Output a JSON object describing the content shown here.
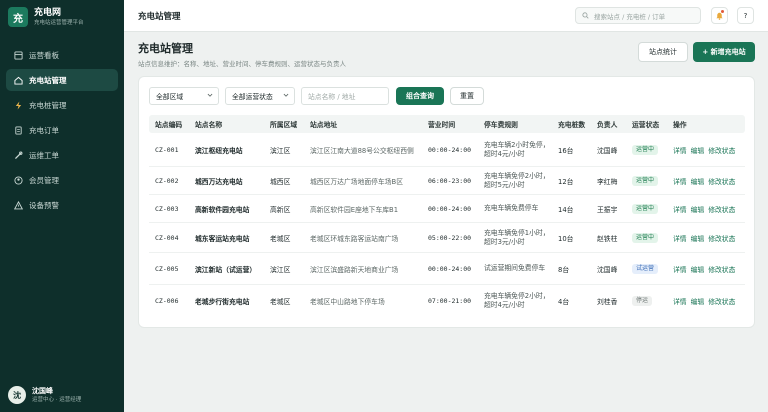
{
  "brand": {
    "logo": "充",
    "name": "充电网",
    "subtitle": "充电站运营管理平台"
  },
  "sidebar": {
    "items": [
      {
        "label": "运营看板",
        "icon": "dashboard-icon"
      },
      {
        "label": "充电站管理",
        "icon": "home-icon",
        "active": true
      },
      {
        "label": "充电桩管理",
        "icon": "bolt-icon"
      },
      {
        "label": "充电订单",
        "icon": "document-icon"
      },
      {
        "label": "运维工单",
        "icon": "wrench-icon"
      },
      {
        "label": "会员管理",
        "icon": "member-icon"
      },
      {
        "label": "设备预警",
        "icon": "warning-icon"
      }
    ]
  },
  "user": {
    "avatar": "沈",
    "name": "沈国峰",
    "role": "运营中心 · 运营经理"
  },
  "topbar": {
    "title": "充电站管理",
    "search_placeholder": "搜索站点 / 充电桩 / 订单",
    "help": "?"
  },
  "page": {
    "title": "充电站管理",
    "desc": "站点信息维护：名称、地址、营业时间、停车费规则、运营状态与负责人",
    "stats_button": "站点统计",
    "add_button": "+ 新增充电站"
  },
  "filters": {
    "region": "全部区域",
    "status": "全部运营状态",
    "keyword_placeholder": "站点名称 / 地址",
    "query_button": "组合查询",
    "reset_button": "重置"
  },
  "table": {
    "headers": [
      "站点编码",
      "站点名称",
      "所属区域",
      "站点地址",
      "营业时间",
      "停车费规则",
      "充电桩数",
      "负责人",
      "运营状态",
      "操作"
    ],
    "rows": [
      {
        "code": "CZ-001",
        "name": "滨江枢纽充电站",
        "region": "滨江区",
        "address": "滨江区江南大道88号公交枢纽西侧",
        "hours": "00:00-24:00",
        "rule": "充电车辆2小时免停，超时4元/小时",
        "piles": "16台",
        "owner": "沈国峰",
        "status": "运营中",
        "status_kind": "green"
      },
      {
        "code": "CZ-002",
        "name": "城西万达充电站",
        "region": "城西区",
        "address": "城西区万达广场地面停车场B区",
        "hours": "06:00-23:00",
        "rule": "充电车辆免停2小时，超时5元/小时",
        "piles": "12台",
        "owner": "李红梅",
        "status": "运营中",
        "status_kind": "green"
      },
      {
        "code": "CZ-003",
        "name": "高新软件园充电站",
        "region": "高新区",
        "address": "高新区软件园E座地下车库B1",
        "hours": "00:00-24:00",
        "rule": "充电车辆免费停车",
        "piles": "14台",
        "owner": "王振宇",
        "status": "运营中",
        "status_kind": "green"
      },
      {
        "code": "CZ-004",
        "name": "城东客运站充电站",
        "region": "老城区",
        "address": "老城区环城东路客运站南广场",
        "hours": "05:00-22:00",
        "rule": "充电车辆免停1小时，超时3元/小时",
        "piles": "10台",
        "owner": "赵铁柱",
        "status": "运营中",
        "status_kind": "green"
      },
      {
        "code": "CZ-005",
        "name": "滨江新站（试运营）",
        "region": "滨江区",
        "address": "滨江区滨盛路新天地商业广场",
        "hours": "00:00-24:00",
        "rule": "试运营期间免费停车",
        "piles": "8台",
        "owner": "沈国峰",
        "status": "试运营",
        "status_kind": "blue"
      },
      {
        "code": "CZ-006",
        "name": "老城步行街充电站",
        "region": "老城区",
        "address": "老城区中山路地下停车场",
        "hours": "07:00-21:00",
        "rule": "充电车辆免停2小时，超时4元/小时",
        "piles": "4台",
        "owner": "刘桂香",
        "status": "停运",
        "status_kind": "gray"
      }
    ],
    "ops": [
      "详情",
      "编辑",
      "修改状态"
    ]
  },
  "colors": {
    "sidebar_bg": "#0e2f2b",
    "accent": "#1a7556"
  }
}
